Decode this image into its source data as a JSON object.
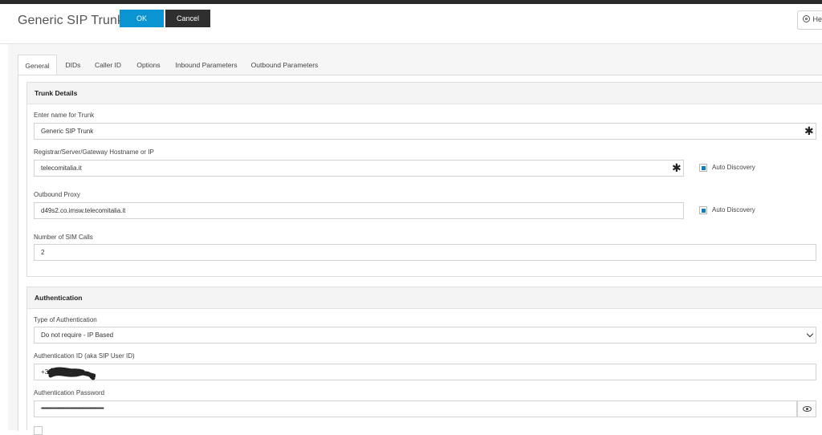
{
  "header": {
    "title": "Generic SIP Trunk",
    "ok_label": "OK",
    "cancel_label": "Cancel",
    "help_label": "Help"
  },
  "tabs": [
    {
      "label": "General",
      "active": true
    },
    {
      "label": "DIDs"
    },
    {
      "label": "Caller ID"
    },
    {
      "label": "Options"
    },
    {
      "label": "Inbound Parameters"
    },
    {
      "label": "Outbound Parameters"
    }
  ],
  "trunk_details": {
    "heading": "Trunk Details",
    "name_label": "Enter name for Trunk",
    "name_value": "Generic SIP Trunk",
    "host_label": "Registrar/Server/Gateway Hostname or IP",
    "host_value": "telecomitalia.it",
    "host_auto_discovery": "Auto Discovery",
    "proxy_label": "Outbound Proxy",
    "proxy_value": "d49s2.co.imsw.telecomitalia.it",
    "proxy_auto_discovery": "Auto Discovery",
    "sim_calls_label": "Number of SIM Calls",
    "sim_calls_value": "2"
  },
  "authentication": {
    "heading": "Authentication",
    "type_label": "Type of Authentication",
    "type_value": "Do not require - IP Based",
    "id_label": "Authentication ID (aka SIP User ID)",
    "id_value": "+39",
    "password_label": "Authentication Password",
    "password_value": "••••••••••••••••••••••••••••••••••••••••••••••••••••••••••••••"
  },
  "colors": {
    "primary": "#0a94d1",
    "cancel": "#2f2f2f",
    "checkbox": "#0e80b0"
  },
  "icons": {
    "required": "asterisk-icon",
    "dropdown": "chevron-down-icon",
    "show_password": "eye-icon",
    "help": "lifebuoy-icon"
  }
}
